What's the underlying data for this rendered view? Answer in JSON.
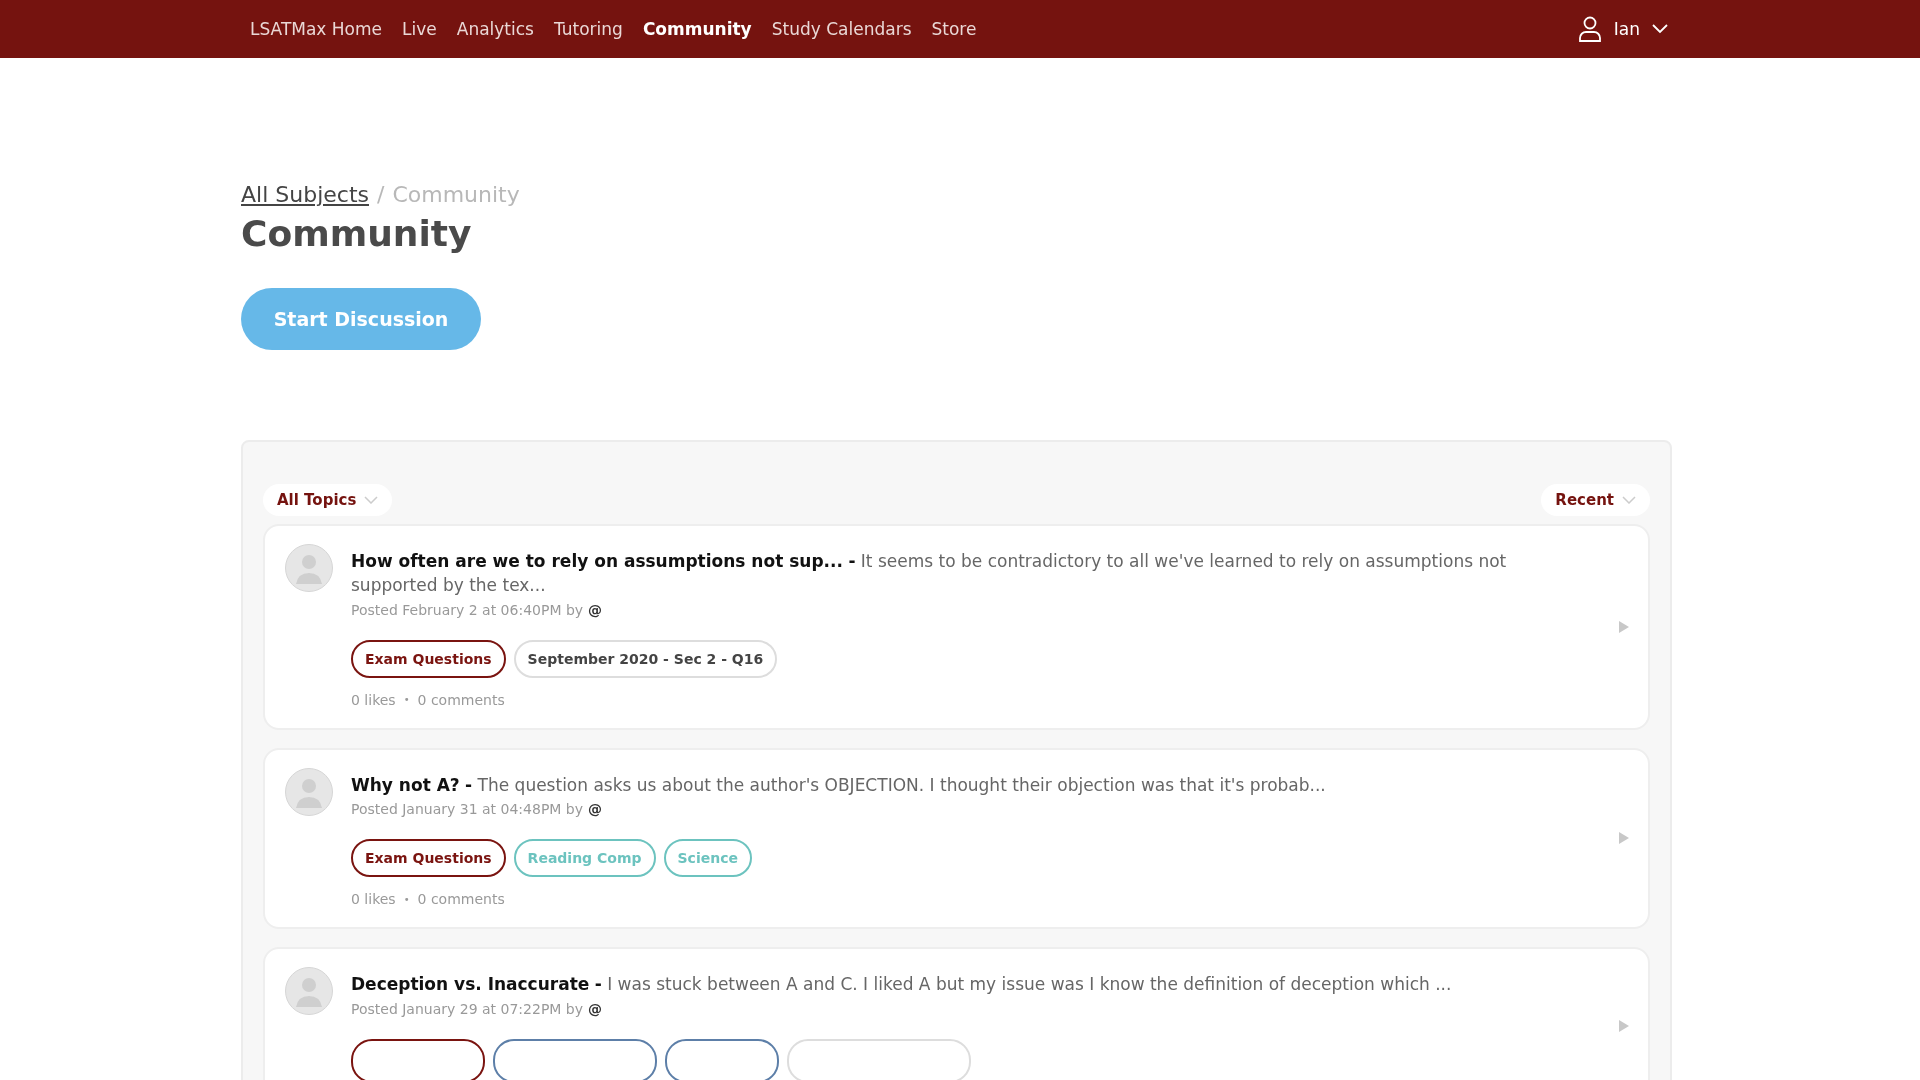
{
  "nav": {
    "items": [
      {
        "label": "LSATMax Home",
        "selected": false
      },
      {
        "label": "Live",
        "selected": false
      },
      {
        "label": "Analytics",
        "selected": false
      },
      {
        "label": "Tutoring",
        "selected": false
      },
      {
        "label": "Community",
        "selected": true
      },
      {
        "label": "Study Calendars",
        "selected": false
      },
      {
        "label": "Store",
        "selected": false
      }
    ],
    "user": "Ian"
  },
  "breadcrumb": {
    "link": "All Subjects",
    "separator": "/",
    "current": "Community"
  },
  "title": "Community",
  "start_button": "Start Discussion",
  "filters": {
    "topic": "All Topics",
    "sort": "Recent"
  },
  "posts": [
    {
      "title": "How often are we to rely on assumptions not sup...",
      "dash": "-",
      "excerpt": "It seems to be contradictory to all we've learned to rely on assumptions not supported by the tex...",
      "posted": "Posted February 2 at 06:40PM by",
      "at": "@",
      "tags": [
        {
          "label": "Exam Questions",
          "color": "#7a1410"
        },
        {
          "label": "September 2020 - Sec 2 - Q16",
          "color": "#dddddd"
        }
      ],
      "likes": "0 likes",
      "bullet": "•",
      "comments": "0 comments"
    },
    {
      "title": "Why not A?",
      "dash": "-",
      "excerpt": "The question asks us about the author's OBJECTION. I thought their objection was that it's probab...",
      "posted": "Posted January 31 at 04:48PM by",
      "at": "@",
      "tags": [
        {
          "label": "Exam Questions",
          "color": "#7a1410"
        },
        {
          "label": "Reading Comp",
          "color": "#6cc3bf"
        },
        {
          "label": "Science",
          "color": "#6cc3bf"
        }
      ],
      "likes": "0 likes",
      "bullet": "•",
      "comments": "0 comments"
    },
    {
      "title": "Deception vs. Inaccurate",
      "dash": "-",
      "excerpt": "I was stuck between A and C. I liked A but my issue was I know the definition of deception which ...",
      "posted": "Posted January 29 at 07:22PM by",
      "at": "@",
      "tags": [
        {
          "color": "#7a1410"
        },
        {
          "color": "#5d7fa8"
        },
        {
          "color": "#5d7fa8"
        },
        {
          "color": "#dddddd"
        }
      ]
    }
  ]
}
